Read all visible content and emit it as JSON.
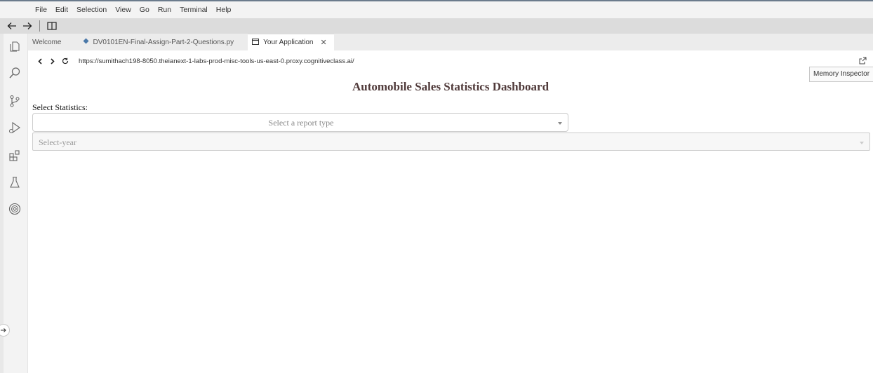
{
  "menu": {
    "items": [
      "File",
      "Edit",
      "Selection",
      "View",
      "Go",
      "Run",
      "Terminal",
      "Help"
    ]
  },
  "toolbar": {
    "icons": [
      "back-arrow-icon",
      "forward-arrow-icon",
      "split-layout-icon"
    ]
  },
  "activity_bar": {
    "icons": [
      "explorer-icon",
      "search-icon",
      "source-control-icon",
      "run-debug-icon",
      "extensions-icon",
      "test-flask-icon",
      "skills-network-icon"
    ]
  },
  "tabs": [
    {
      "label": "Welcome",
      "icon": "",
      "active": false
    },
    {
      "label": "DV0101EN-Final-Assign-Part-2-Questions.py",
      "icon": "python-file-icon",
      "active": false
    },
    {
      "label": "Your Application",
      "icon": "window-icon",
      "active": true
    }
  ],
  "browser": {
    "url": "https://sumithach198-8050.theianext-1-labs-prod-misc-tools-us-east-0.proxy.cognitiveclass.ai/"
  },
  "memory_inspector": {
    "label": "Memory Inspector"
  },
  "dashboard": {
    "title": "Automobile Sales Statistics Dashboard",
    "select_label": "Select Statistics:",
    "report_dropdown_placeholder": "Select a report type",
    "year_dropdown_placeholder": "Select-year"
  },
  "colors": {
    "title": "#503a3a",
    "active_tab": "#ffffff",
    "tab_bar": "#ececec",
    "menu_bar": "#f3f3f3",
    "toolbar": "#dcdcdc"
  }
}
